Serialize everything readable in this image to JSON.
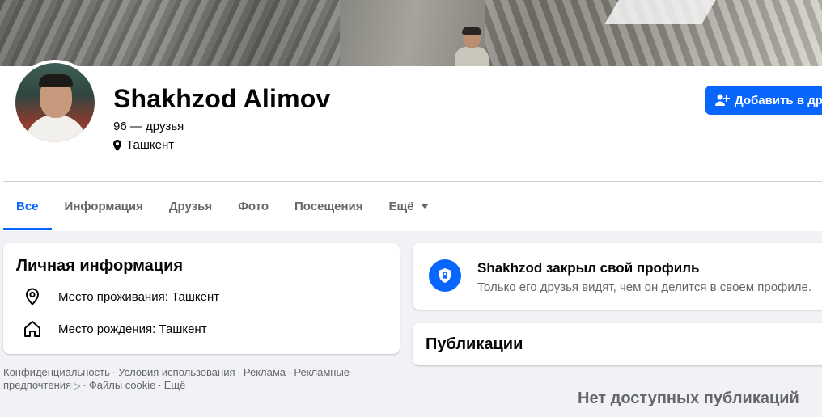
{
  "profile": {
    "name": "Shakhzod Alimov",
    "friends": "96 — друзья",
    "location": "Ташкент",
    "add_friend_button": "Добавить в дру"
  },
  "tabs": [
    {
      "label": "Все",
      "active": true
    },
    {
      "label": "Информация",
      "active": false
    },
    {
      "label": "Друзья",
      "active": false
    },
    {
      "label": "Фото",
      "active": false
    },
    {
      "label": "Посещения",
      "active": false
    },
    {
      "label": "Ещё",
      "active": false
    }
  ],
  "personal_info": {
    "title": "Личная информация",
    "residence": "Место проживания: Ташкент",
    "birthplace": "Место рождения: Ташкент"
  },
  "locked": {
    "title": "Shakhzod закрыл свой профиль",
    "subtitle": "Только его друзья видят, чем он делится в своем профиле."
  },
  "posts": {
    "title": "Публикации",
    "empty": "Нет доступных публикаций"
  },
  "footer": {
    "links": [
      "Конфиденциальность",
      "Условия использования",
      "Реклама",
      "Рекламные предпочтения",
      "Файлы cookie",
      "Ещё"
    ]
  },
  "colors": {
    "accent": "#0866ff",
    "background": "#f0f2f5",
    "secondary_text": "#65676b"
  },
  "icons": {
    "add_friend": "person-plus-icon",
    "location": "map-pin-icon",
    "home": "home-icon",
    "shield": "shield-lock-icon",
    "dropdown": "caret-down-icon",
    "adchoices": "adchoices-icon"
  }
}
